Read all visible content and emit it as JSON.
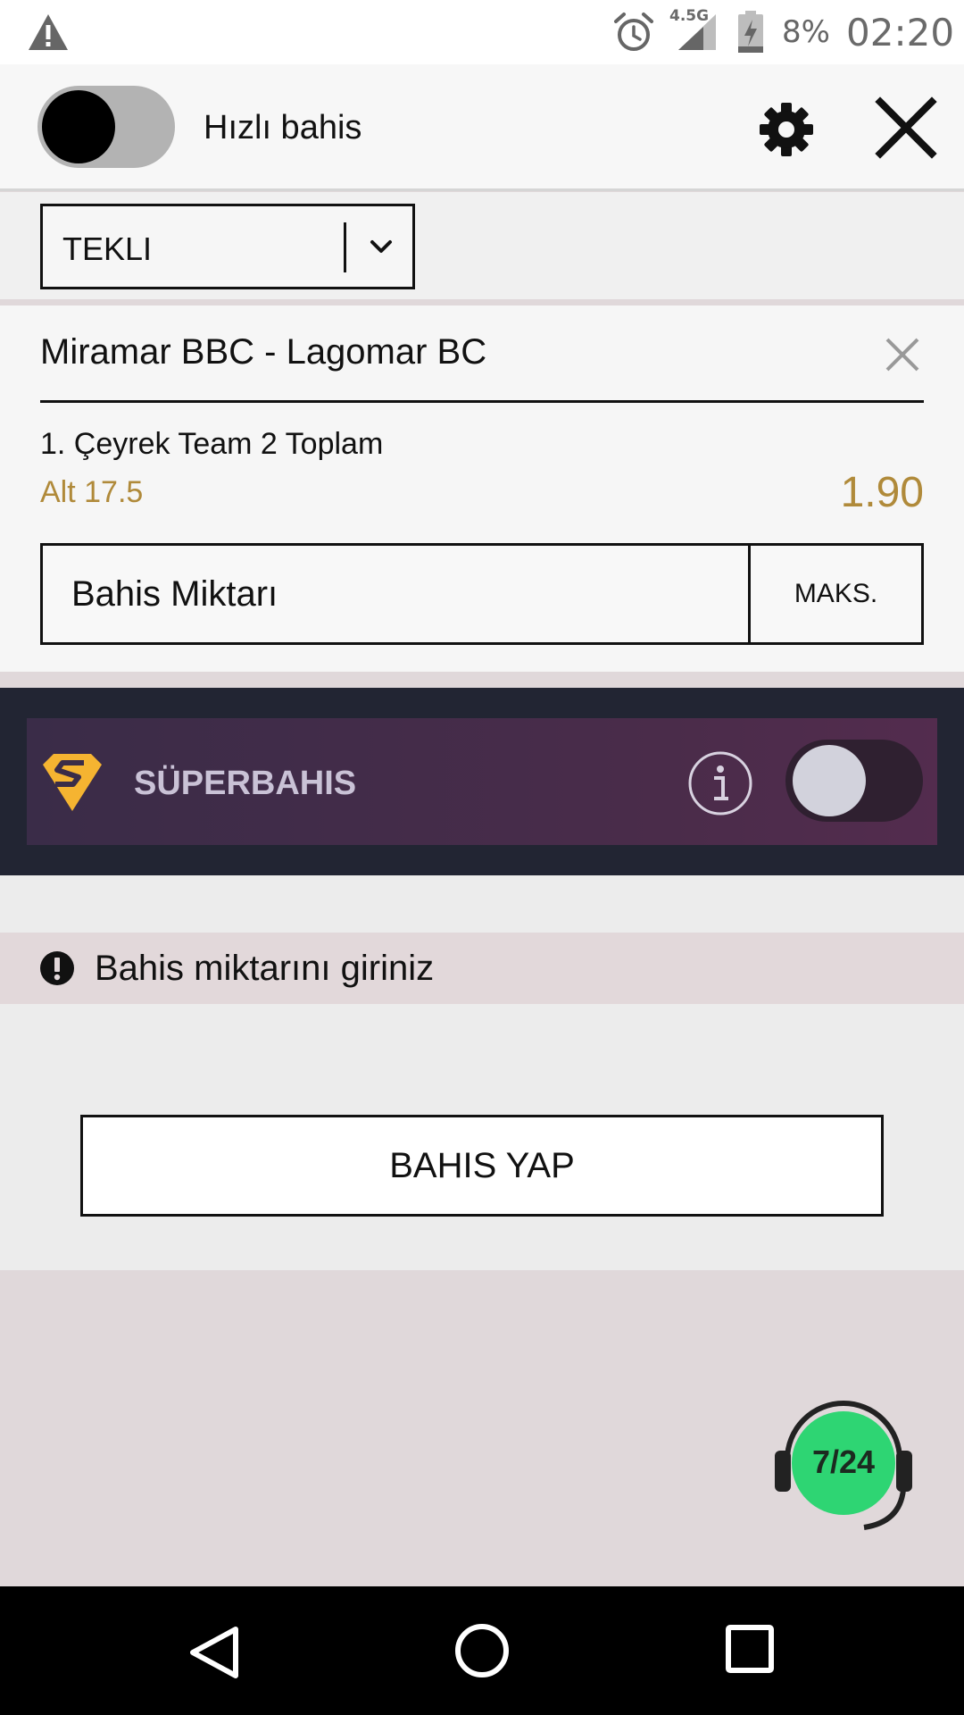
{
  "status_bar": {
    "network": "4.5G",
    "battery": "8%",
    "time": "02:20"
  },
  "header": {
    "quick_bet_label": "Hızlı bahis",
    "quick_bet_enabled": false
  },
  "bet_type": {
    "selected": "TEKLI"
  },
  "bet": {
    "match": "Miramar BBC - Lagomar BC",
    "market": "1. Çeyrek Team 2 Toplam",
    "selection": "Alt 17.5",
    "odds": "1.90",
    "stake_placeholder": "Bahis Miktarı",
    "max_label": "MAKS."
  },
  "superbahis": {
    "label": "SÜPERBAHIS",
    "enabled": false
  },
  "warning": {
    "text": "Bahis miktarını giriniz"
  },
  "place_bet": {
    "label": "BAHIS YAP"
  },
  "support": {
    "label": "7/24"
  },
  "colors": {
    "accent_gold": "#b08a3a",
    "super_band": "#222533",
    "super_panel": "#4a2c4a",
    "support_green": "#2ed573"
  }
}
